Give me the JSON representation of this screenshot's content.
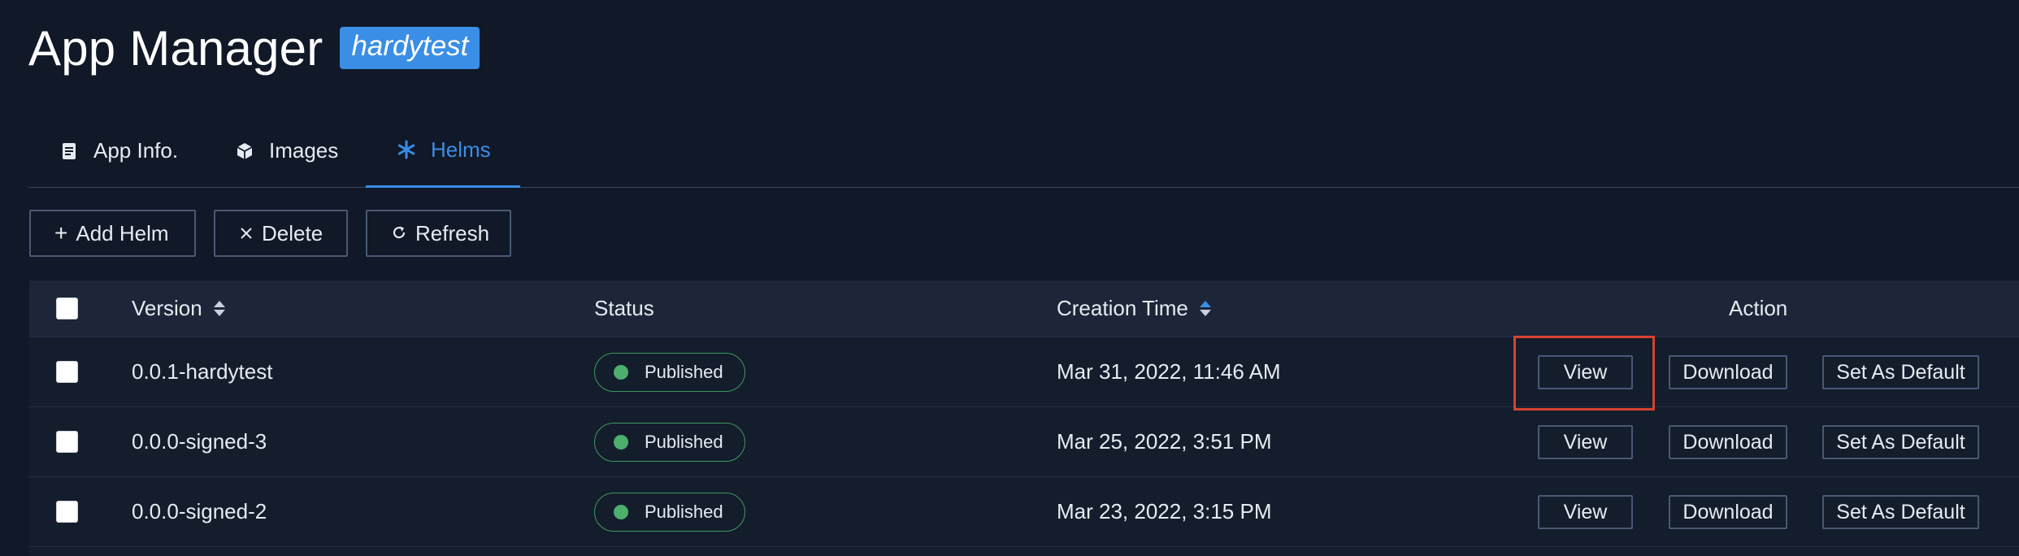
{
  "header": {
    "title": "App Manager",
    "badge": "hardytest"
  },
  "tabs": [
    {
      "label": "App Info.",
      "icon": "document-icon",
      "active": false
    },
    {
      "label": "Images",
      "icon": "cube-icon",
      "active": false
    },
    {
      "label": "Helms",
      "icon": "asterisk-icon",
      "active": true
    }
  ],
  "toolbar": {
    "add_label": "Add Helm",
    "delete_label": "Delete",
    "refresh_label": "Refresh"
  },
  "table": {
    "columns": {
      "version": "Version",
      "status": "Status",
      "creation_time": "Creation Time",
      "action": "Action"
    },
    "rows": [
      {
        "version": "0.0.1-hardytest",
        "status": "Published",
        "created": "Mar 31, 2022, 11:46 AM",
        "view": "View",
        "download": "Download",
        "set_default": "Set As Default"
      },
      {
        "version": "0.0.0-signed-3",
        "status": "Published",
        "created": "Mar 25, 2022, 3:51 PM",
        "view": "View",
        "download": "Download",
        "set_default": "Set As Default"
      },
      {
        "version": "0.0.0-signed-2",
        "status": "Published",
        "created": "Mar 23, 2022, 3:15 PM",
        "view": "View",
        "download": "Download",
        "set_default": "Set As Default"
      }
    ]
  },
  "colors": {
    "background": "#111827",
    "accent": "#3a8ee6",
    "status_published": "#4caf6d",
    "highlight": "#d5432f"
  }
}
